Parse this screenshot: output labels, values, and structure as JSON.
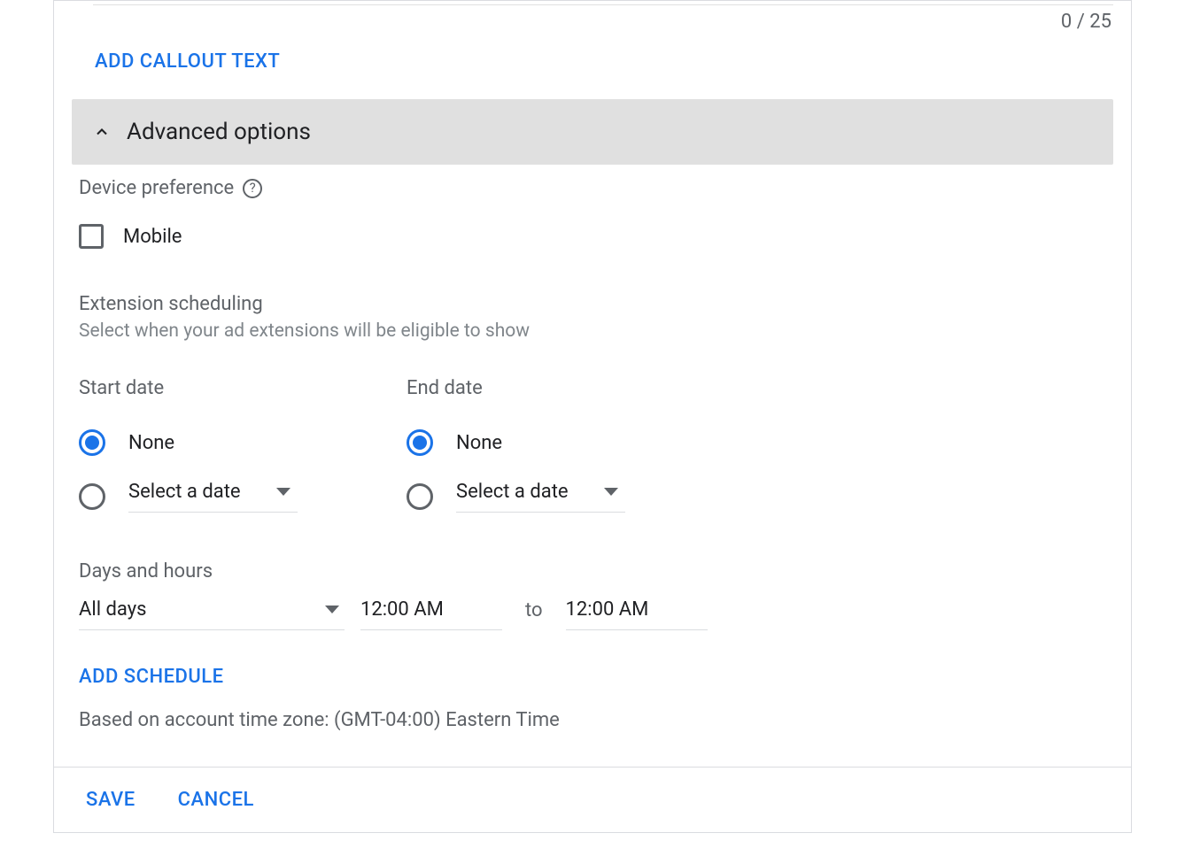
{
  "counter": "0 / 25",
  "add_callout_label": "ADD CALLOUT TEXT",
  "advanced": {
    "title": "Advanced options",
    "device_pref_label": "Device preference",
    "mobile_label": "Mobile",
    "mobile_checked": false,
    "scheduling_title": "Extension scheduling",
    "scheduling_desc": "Select when your ad extensions will be eligible to show",
    "start_date": {
      "label": "Start date",
      "none_label": "None",
      "select_label": "Select a date",
      "selected": "none"
    },
    "end_date": {
      "label": "End date",
      "none_label": "None",
      "select_label": "Select a date",
      "selected": "none"
    },
    "days_hours_label": "Days and hours",
    "schedule_row": {
      "days": "All days",
      "from": "12:00 AM",
      "to_label": "to",
      "to": "12:00 AM"
    },
    "add_schedule_label": "ADD SCHEDULE",
    "timezone_note": "Based on account time zone: (GMT-04:00) Eastern Time"
  },
  "footer": {
    "save_label": "SAVE",
    "cancel_label": "CANCEL"
  }
}
